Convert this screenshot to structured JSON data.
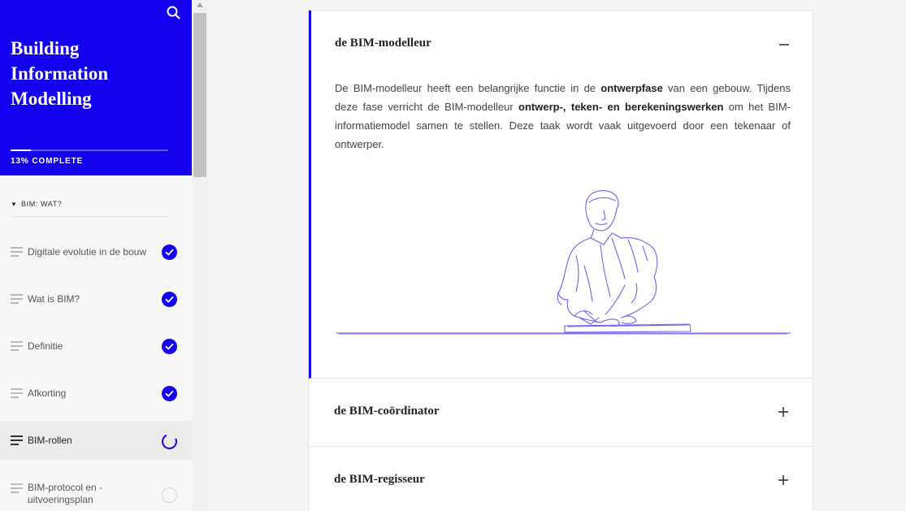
{
  "sidebar": {
    "course_title": "Building Information Modelling",
    "progress": {
      "value": 0.13,
      "label": "13% COMPLETE"
    },
    "section": {
      "label": "BIM: WAT?"
    },
    "lessons": [
      {
        "label": "Digitale evolutie in de bouw",
        "status": "complete"
      },
      {
        "label": "Wat is BIM?",
        "status": "complete"
      },
      {
        "label": "Definitie",
        "status": "complete"
      },
      {
        "label": "Afkorting",
        "status": "complete"
      },
      {
        "label": "BIM-rollen",
        "status": "in-progress"
      },
      {
        "label": "BIM-protocol en -uitvoeringsplan",
        "status": "not-started"
      }
    ]
  },
  "accordion": {
    "items": [
      {
        "title": "de BIM-modelleur",
        "expanded": true,
        "body": {
          "p1": "De BIM-modelleur heeft een belangrijke functie in de ",
          "b1": "ontwerpfase",
          "p2": " van een gebouw. Tijdens deze fase verricht de BIM-modelleur ",
          "b2": "ontwerp-, teken- en berekeningswerken",
          "p3": " om het BIM-informatiemodel samen te stellen. Deze taak wordt vaak uitgevoerd door een tekenaar of ontwerper."
        }
      },
      {
        "title": "de BIM-coördinator",
        "expanded": false
      },
      {
        "title": "de BIM-regisseur",
        "expanded": false
      }
    ]
  },
  "icons": {
    "search": "search-icon",
    "collapse": "minus-icon",
    "expand": "plus-icon",
    "complete": "check-circle-icon",
    "lesson": "lesson-lines-icon"
  },
  "colors": {
    "accent": "#1200ef",
    "illustration_line": "#6b62f0"
  }
}
